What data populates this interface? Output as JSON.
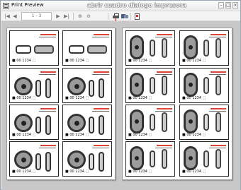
{
  "window": {
    "title": "Print Preview",
    "controls": {
      "minimize": "–",
      "maximize": "□",
      "close": "×"
    }
  },
  "toolbar": {
    "first": "|◀",
    "prev": "◀",
    "page_range": "1 - 3",
    "next": "▶",
    "last": "▶|",
    "zoom_in": "⊕",
    "zoom_out": "⊖",
    "annotation": "abrir cuadro dialogo impresora"
  },
  "pages": [
    {
      "cards": [
        {
          "code": "■ 00 1234  ⬚"
        },
        {
          "code": "■ 00 1234  ⬚"
        },
        {
          "code": "■ 00 1234  ⬚"
        },
        {
          "code": "■ 00 1234  ⬚"
        },
        {
          "code": "■ 00 1234  ⬚"
        },
        {
          "code": "■ 00 1234  ⬚"
        },
        {
          "code": "■ 00 1234  ⬚"
        },
        {
          "code": "■ 00 1234  ⬚"
        }
      ]
    },
    {
      "cards": [
        {
          "code": "■ 00 1234  ⬚"
        },
        {
          "code": "■ 00 1234  ⬚"
        },
        {
          "code": "■ 00 1234  ⬚"
        },
        {
          "code": "■ 00 1234  ⬚"
        },
        {
          "code": "■ 00 1234  ⬚"
        },
        {
          "code": "■ 00 1234  ⬚"
        },
        {
          "code": "■ 00 1234  ⬚"
        },
        {
          "code": "■ 00 1234  ⬚"
        }
      ]
    }
  ]
}
